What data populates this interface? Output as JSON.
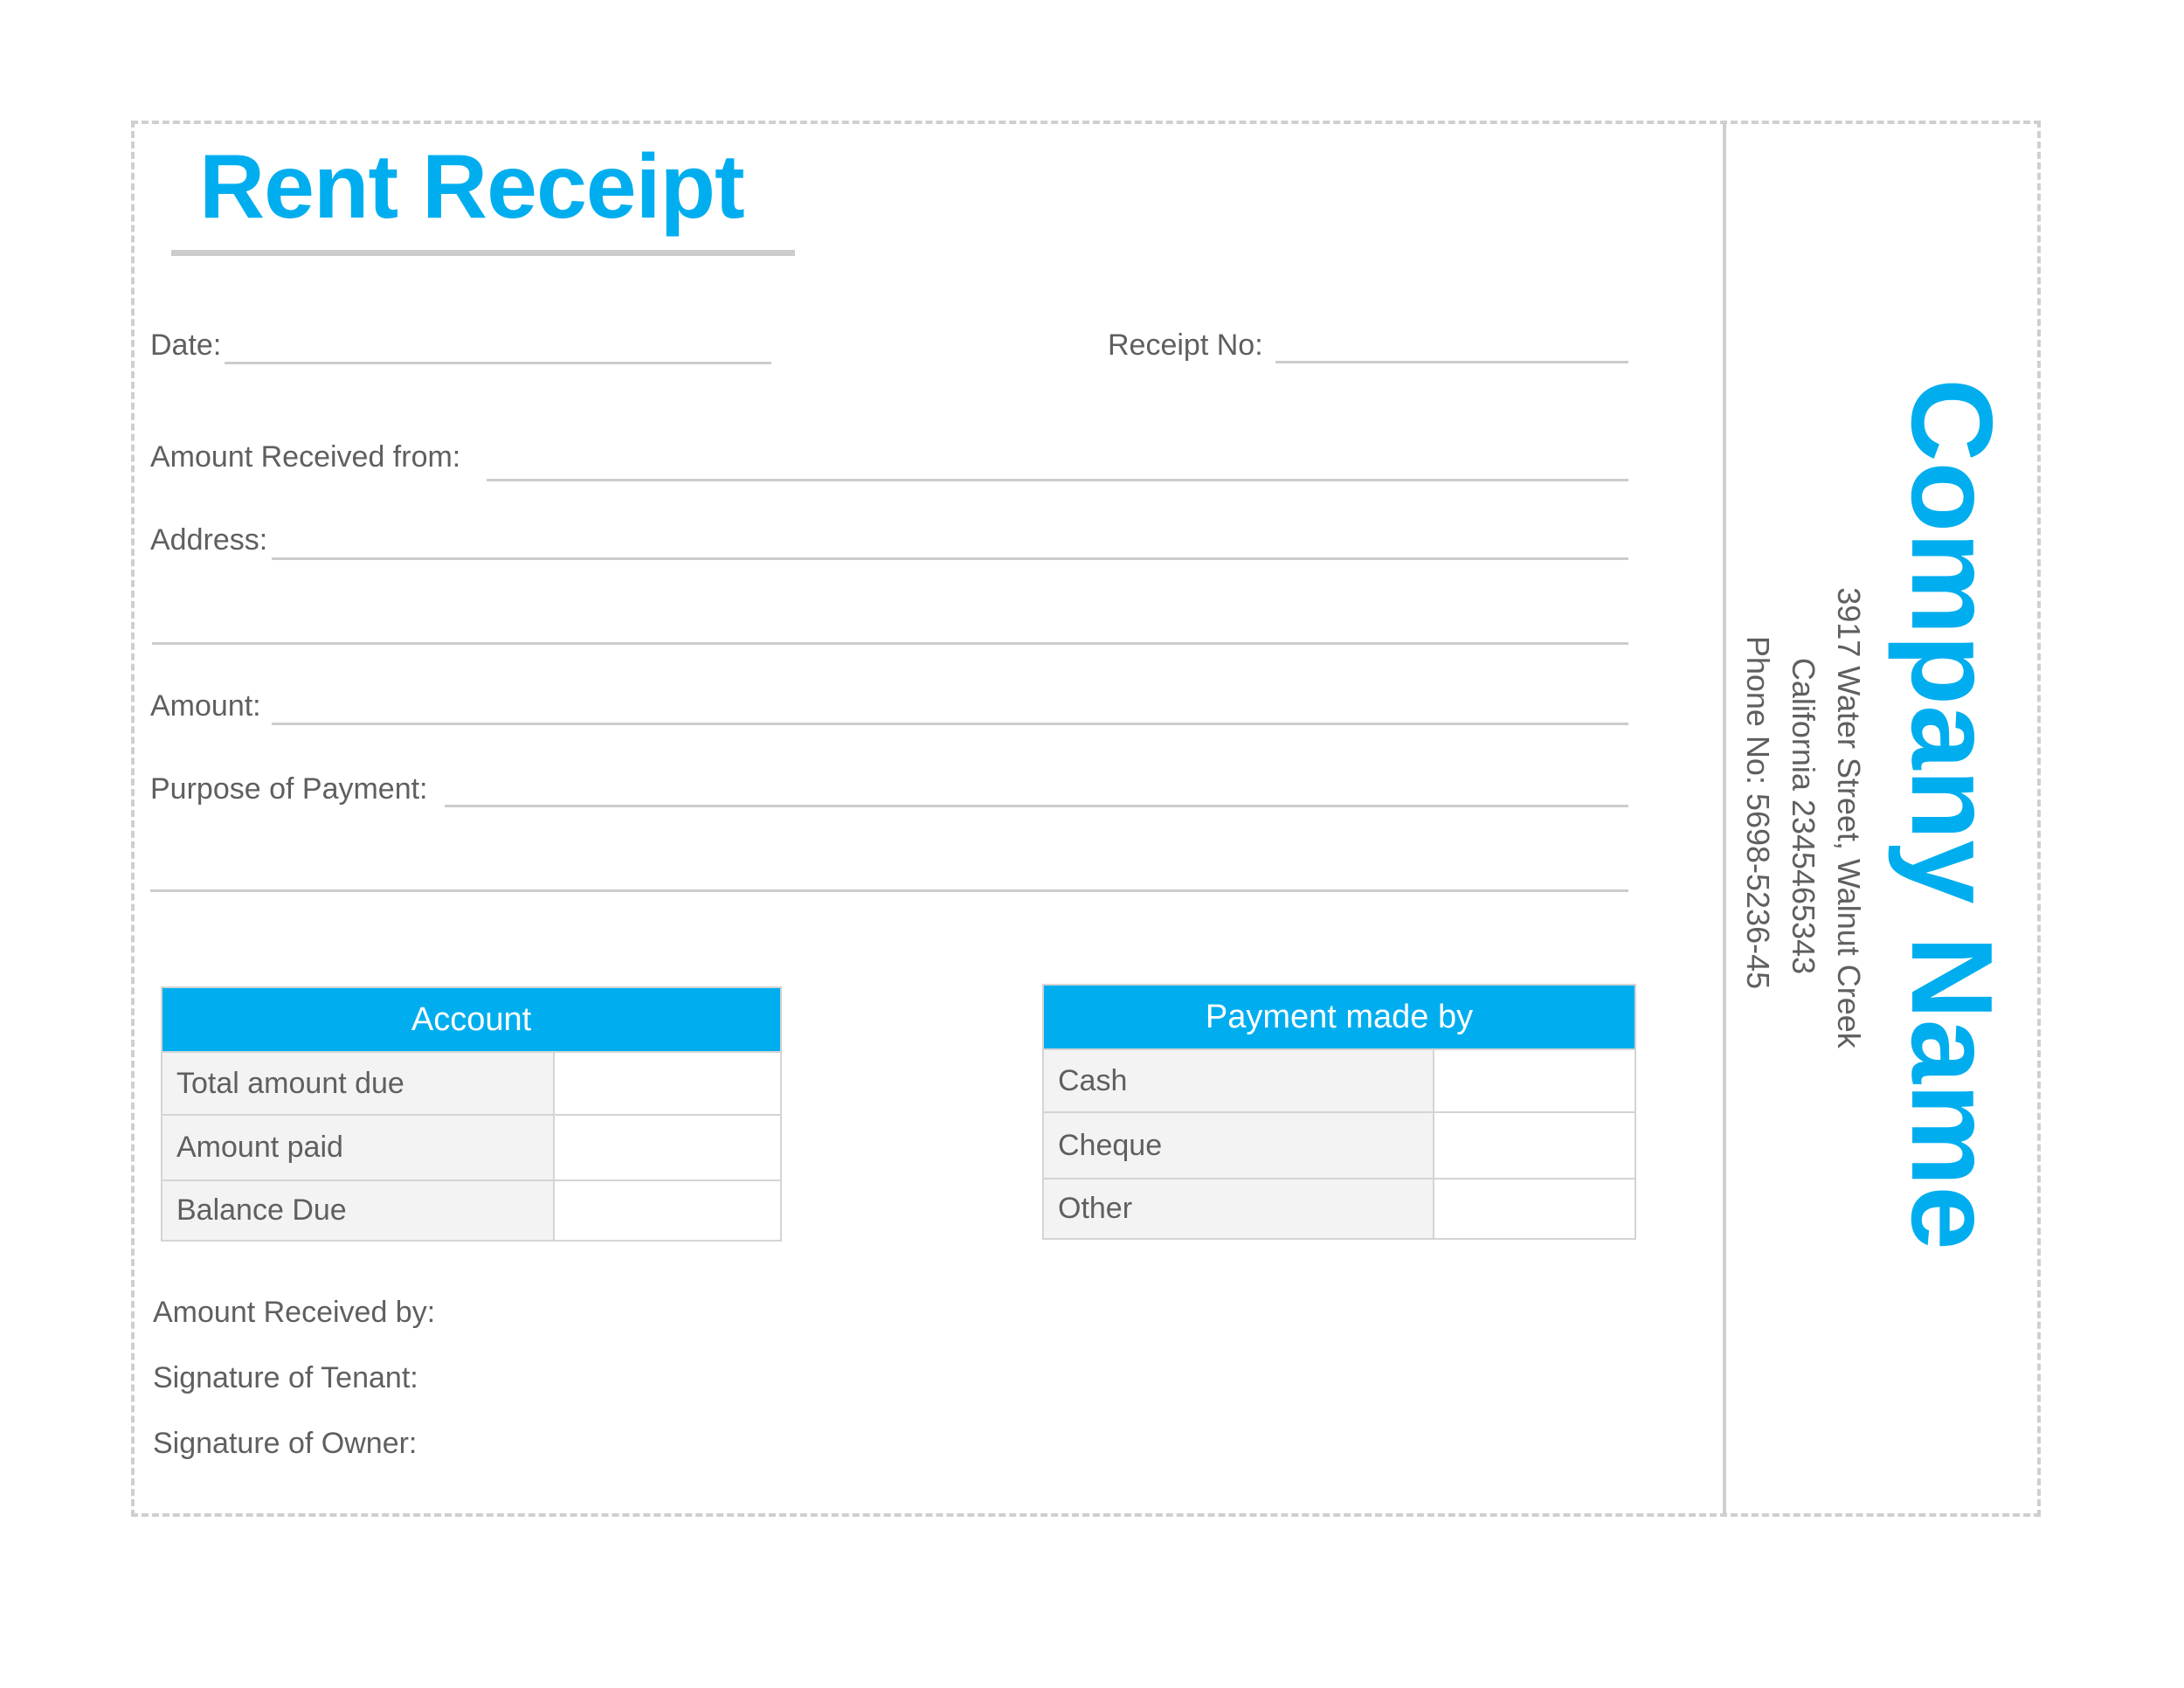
{
  "title": "Rent Receipt",
  "colors": {
    "accent": "#00aeef",
    "line": "#cccccc",
    "text": "#5f5f5f",
    "cell_bg": "#f3f3f3"
  },
  "fields": {
    "date": {
      "label": "Date:",
      "value": ""
    },
    "receipt_no": {
      "label": "Receipt No:",
      "value": ""
    },
    "received_from": {
      "label": "Amount Received from:",
      "value": ""
    },
    "address": {
      "label": "Address:",
      "value": "",
      "value_line2": ""
    },
    "amount": {
      "label": "Amount:",
      "value": ""
    },
    "purpose": {
      "label": "Purpose of Payment:",
      "value": "",
      "value_line2": ""
    }
  },
  "account_table": {
    "header": "Account",
    "rows": [
      {
        "label": "Total amount due",
        "value": ""
      },
      {
        "label": "Amount paid",
        "value": ""
      },
      {
        "label": "Balance Due",
        "value": ""
      }
    ]
  },
  "payment_table": {
    "header": "Payment made by",
    "rows": [
      {
        "label": "Cash",
        "value": ""
      },
      {
        "label": "Cheque",
        "value": ""
      },
      {
        "label": "Other",
        "value": ""
      }
    ]
  },
  "signatures": {
    "received_by": "Amount Received by:",
    "tenant": "Signature of Tenant:",
    "owner": "Signature of Owner:"
  },
  "company": {
    "name": "Company Name",
    "address_line1": "3917 Water Street, Walnut Creek",
    "address_line2": "California 2345465343",
    "phone": "Phone No: 5698-5236-45"
  }
}
